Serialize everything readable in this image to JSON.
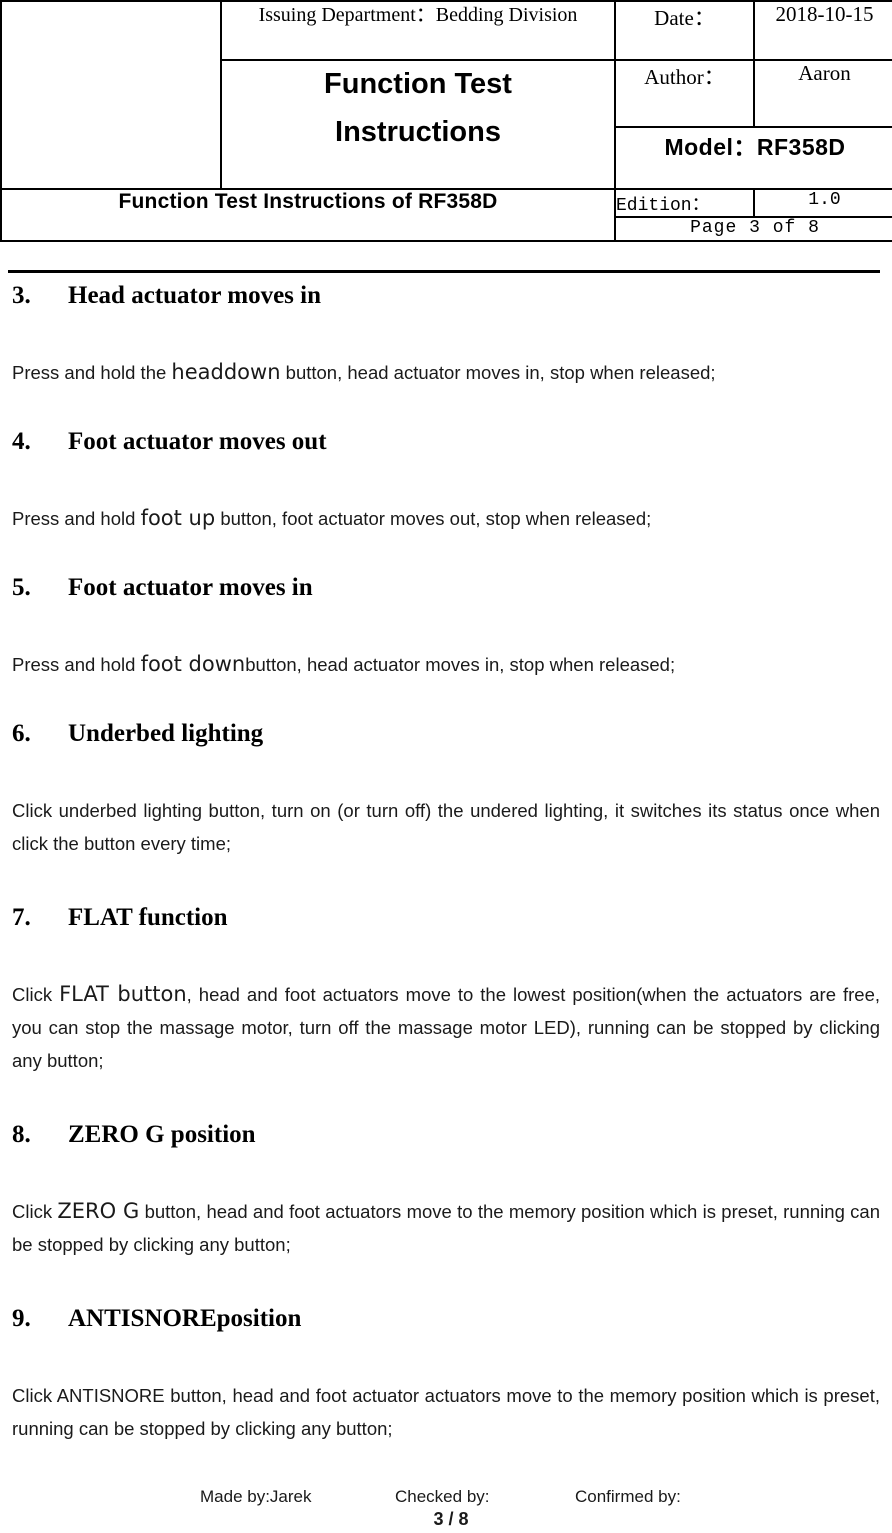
{
  "header": {
    "logo_cell": "",
    "issuing_department": "Issuing Department：Bedding Division",
    "doc_title": "Function Test\nInstructions",
    "date_label": "Date：",
    "date_value": "2018-10-15",
    "author_label": "Author：",
    "author_value": "Aaron",
    "model_line": "Model：RF358D",
    "doc_name": "Function Test Instructions of RF358D",
    "edition_label": "Edition：",
    "edition_value": "1.0",
    "page_indicator": "Page 3 of 8"
  },
  "sections": [
    {
      "number": "3.",
      "title": "Head actuator moves in",
      "para_pre": "Press and hold the ",
      "para_term": "headdown",
      "para_post": " button, head actuator moves in, stop when released;"
    },
    {
      "number": "4.",
      "title": "Foot actuator moves out",
      "para_pre": "Press and hold ",
      "para_term": "foot up",
      "para_post": " button, foot actuator moves out, stop when released;"
    },
    {
      "number": "5.",
      "title": "Foot actuator moves in",
      "para_pre": "Press and hold ",
      "para_term": "foot down",
      "para_post": "button, head actuator moves in, stop when released;"
    },
    {
      "number": "6.",
      "title": "Underbed lighting",
      "para_pre": "Click underbed lighting button, turn on (or turn off) the undered lighting, it switches its status once when click the button every time;",
      "para_term": "",
      "para_post": ""
    },
    {
      "number": "7.",
      "title": "FLAT function",
      "para_pre": "Click ",
      "para_term": "FLAT button",
      "para_post": ", head and foot actuators move to the lowest position(when the actuators are free, you can stop the massage motor, turn off the massage motor LED), running can be stopped by clicking any button;"
    },
    {
      "number": "8.",
      "title": "ZERO G position",
      "para_pre": "Click ",
      "para_term": "ZERO G",
      "para_post": " button, head and foot actuators move to the memory position which is preset, running can be stopped by clicking any button;"
    },
    {
      "number": "9.",
      "title": "ANTISNOREposition",
      "para_pre": "Click ANTISNORE button, head and foot actuator actuators move to the memory position which is preset, running can be stopped by clicking any button;",
      "para_term": "",
      "para_post": ""
    }
  ],
  "footer": {
    "made_by": "Made by:Jarek",
    "checked_by": "Checked by:",
    "confirmed_by": "Confirmed by:",
    "page_number": "3 / 8"
  }
}
